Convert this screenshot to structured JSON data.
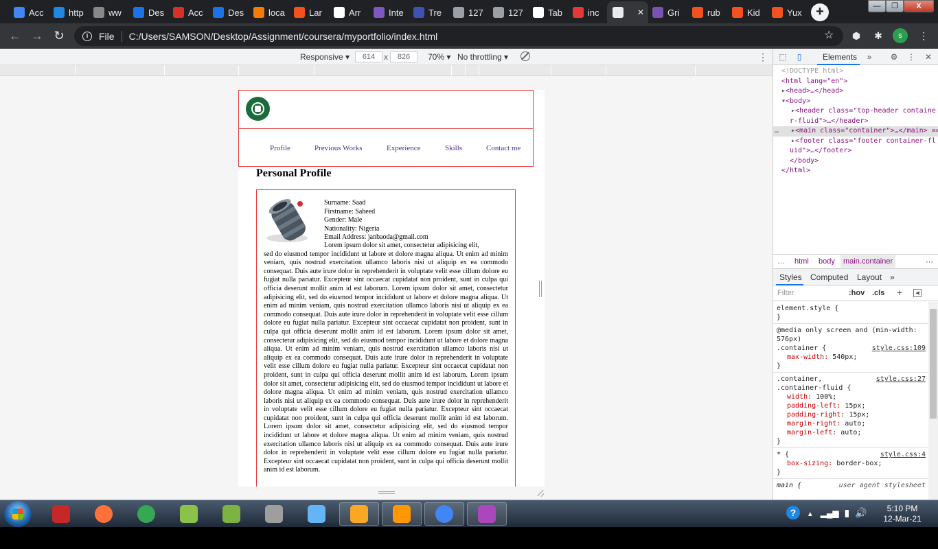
{
  "browser": {
    "tabs": [
      {
        "label": "Acc",
        "icon": "doc-icon",
        "color": "#4285f4"
      },
      {
        "label": "http",
        "icon": "video-icon",
        "color": "#1e88e5"
      },
      {
        "label": "ww",
        "icon": "loading-icon",
        "color": "#888888"
      },
      {
        "label": "Des",
        "icon": "c-logo-icon",
        "color": "#1a73e8"
      },
      {
        "label": "Acc",
        "icon": "s-logo-icon",
        "color": "#d93025"
      },
      {
        "label": "Des",
        "icon": "c-logo-icon",
        "color": "#1a73e8"
      },
      {
        "label": "loca",
        "icon": "xampp-icon",
        "color": "#f57c00"
      },
      {
        "label": "Lar",
        "icon": "laravel-icon",
        "color": "#f4511e"
      },
      {
        "label": "Arr",
        "icon": "bird-icon",
        "color": "#ffffff"
      },
      {
        "label": "Inte",
        "icon": "list-icon",
        "color": "#7e57c2"
      },
      {
        "label": "Tre",
        "icon": "square-icon",
        "color": "#3f51b5"
      },
      {
        "label": "127",
        "icon": "globe-icon",
        "color": "#9aa0a6"
      },
      {
        "label": "127",
        "icon": "globe-icon",
        "color": "#9aa0a6"
      },
      {
        "label": "Tab",
        "icon": "github-icon",
        "color": "#ffffff"
      },
      {
        "label": "inc",
        "icon": "spinner-icon",
        "color": "#e53935"
      },
      {
        "label": "",
        "icon": "globe-icon",
        "color": "#e8eaed",
        "active": true
      },
      {
        "label": "Gri",
        "icon": "bootstrap-icon",
        "color": "#7952b3"
      },
      {
        "label": "rub",
        "icon": "shield-icon",
        "color": "#f4511e"
      },
      {
        "label": "Kid",
        "icon": "shield-icon",
        "color": "#f4511e"
      },
      {
        "label": "Yux",
        "icon": "shield-icon",
        "color": "#f4511e"
      }
    ],
    "new_tab_label": "+",
    "window_buttons": [
      "—",
      "❐",
      "X"
    ],
    "address": {
      "scheme": "File",
      "url": "C:/Users/SAMSON/Desktop/Assignment/coursera/myportfolio/index.html"
    },
    "profile_initial": "s",
    "accent": "#1a73e8"
  },
  "device_toolbar": {
    "mode": "Responsive",
    "width": "614",
    "height": "826",
    "times": "x",
    "zoom": "70%",
    "throttling": "No throttling"
  },
  "page": {
    "nav": [
      "Profile",
      "Previous Works",
      "Experience",
      "Skills",
      "Contact me"
    ],
    "section_title": "Personal Profile",
    "details": [
      "Surname: Saad",
      "Firstname: Saheed",
      "Gender: Male",
      "Nationality: Nigeria",
      "Email Address: janbaoda@gmail.com"
    ],
    "lorem_first": "Lorem ipsum dolor sit amet, consectetur adipisicing elit,",
    "lorem_rest": "sed do eiusmod tempor incididunt ut labore et dolore magna aliqua. Ut enim ad minim veniam, quis nostrud exercitation ullamco laboris nisi ut aliquip ex ea commodo consequat. Duis aute irure dolor in reprehenderit in voluptate velit esse cillum dolore eu fugiat nulla pariatur. Excepteur sint occaecat cupidatat non proident, sunt in culpa qui officia deserunt mollit anim id est laborum. Lorem ipsum dolor sit amet, consectetur adipisicing elit, sed do eiusmod tempor incididunt ut labore et dolore magna aliqua. Ut enim ad minim veniam, quis nostrud exercitation ullamco laboris nisi ut aliquip ex ea commodo consequat. Duis aute irure dolor in reprehenderit in voluptate velit esse cillum dolore eu fugiat nulla pariatur. Excepteur sint occaecat cupidatat non proident, sunt in culpa qui officia deserunt mollit anim id est laborum. Lorem ipsum dolor sit amet, consectetur adipisicing elit, sed do eiusmod tempor incididunt ut labore et dolore magna aliqua. Ut enim ad minim veniam, quis nostrud exercitation ullamco laboris nisi ut aliquip ex ea commodo consequat. Duis aute irure dolor in reprehenderit in voluptate velit esse cillum dolore eu fugiat nulla pariatur. Excepteur sint occaecat cupidatat non proident, sunt in culpa qui officia deserunt mollit anim id est laborum. Lorem ipsum dolor sit amet, consectetur adipisicing elit, sed do eiusmod tempor incididunt ut labore et dolore magna aliqua. Ut enim ad minim veniam, quis nostrud exercitation ullamco laboris nisi ut aliquip ex ea commodo consequat. Duis aute irure dolor in reprehenderit in voluptate velit esse cillum dolore eu fugiat nulla pariatur. Excepteur sint occaecat cupidatat non proident, sunt in culpa qui officia deserunt mollit anim id est laborum. Lorem ipsum dolor sit amet, consectetur adipisicing elit, sed do eiusmod tempor incididunt ut labore et dolore magna aliqua. Ut enim ad minim veniam, quis nostrud exercitation ullamco laboris nisi ut aliquip ex ea commodo consequat. Duis aute irure dolor in reprehenderit in voluptate velit esse cillum dolore eu fugiat nulla pariatur. Excepteur sint occaecat cupidatat non proident, sunt in culpa qui officia deserunt mollit anim id est laborum.",
    "border_color": "#e83a3a",
    "link_color": "#4b2e83"
  },
  "devtools": {
    "tab_elements": "Elements",
    "dom": {
      "doctype": "<!DOCTYPE html>",
      "html_open": "<html lang=\"en\">",
      "head": "<head>…</head>",
      "body_open": "<body>",
      "header_a": "<header class=\"top-header containe",
      "header_b": "r-fluid\">…</header>",
      "main": "<main class=\"container\">…</main> ==",
      "footer_a": "<footer class=\"footer container-fl",
      "footer_b": "uid\">…</footer>",
      "body_close": "</body>",
      "html_close": "</html>"
    },
    "breadcrumbs": [
      "…",
      "html",
      "body",
      "main.container"
    ],
    "style_tabs": [
      "Styles",
      "Computed",
      "Layout",
      "»"
    ],
    "filter_placeholder": "Filter",
    "hov": ":hov",
    "cls": ".cls",
    "rules": [
      {
        "selector": "element.style {",
        "source": "",
        "props": [],
        "close": "}"
      },
      {
        "selector": "@media only screen and (min-width: 576px)",
        "selector2": ".container {",
        "source": "style.css:109",
        "props": [
          [
            "max-width",
            "540px;"
          ]
        ],
        "close": "}"
      },
      {
        "selector": ".container,",
        "selector2": ".container-fluid {",
        "source": "style.css:27",
        "props": [
          [
            "width",
            "100%;"
          ],
          [
            "padding-left",
            "15px;"
          ],
          [
            "padding-right",
            "15px;"
          ],
          [
            "margin-right",
            "auto;"
          ],
          [
            "margin-left",
            "auto;"
          ]
        ],
        "close": "}"
      },
      {
        "selector": "* {",
        "source": "style.css:4",
        "props": [
          [
            "box-sizing",
            "border-box;"
          ]
        ],
        "close": "}"
      },
      {
        "selector": "main {",
        "source": "user agent stylesheet",
        "props": [],
        "close": ""
      }
    ]
  },
  "taskbar": {
    "apps": [
      {
        "name": "snipping-tool",
        "color": "#c62828"
      },
      {
        "name": "firefox",
        "color": "#ff7139"
      },
      {
        "name": "chrome",
        "color": "#34a853"
      },
      {
        "name": "utility",
        "color": "#8bc34a"
      },
      {
        "name": "chameleon",
        "color": "#7cb342"
      },
      {
        "name": "pen-tool",
        "color": "#9e9e9e"
      },
      {
        "name": "virtualbox",
        "color": "#64b5f6"
      },
      {
        "name": "file-explorer",
        "color": "#f9a825"
      },
      {
        "name": "sublime-text",
        "color": "#ff9800"
      },
      {
        "name": "chrome-active",
        "color": "#4285f4"
      },
      {
        "name": "paint",
        "color": "#ab47bc"
      }
    ],
    "time": "5:10 PM",
    "date": "12-Mar-21"
  }
}
